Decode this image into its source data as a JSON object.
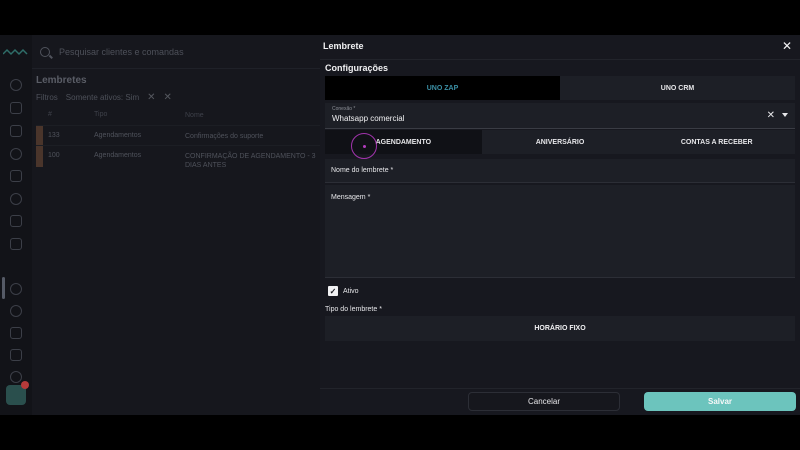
{
  "app": {
    "search_placeholder": "Pesquisar clientes e comandas",
    "page_title": "Lembretes",
    "filters_label": "Filtros",
    "filter_chip": "Somente ativos: Sim",
    "table": {
      "headers": [
        "#",
        "Tipo",
        "Nome"
      ],
      "rows": [
        {
          "id": "133",
          "tipo": "Agendamentos",
          "nome": "Confirmações do suporte"
        },
        {
          "id": "100",
          "tipo": "Agendamentos",
          "nome": "CONFIRMAÇÃO DE AGENDAMENTO - 3 DIAS ANTES"
        }
      ]
    }
  },
  "drawer": {
    "title": "Lembrete",
    "section_title": "Configurações",
    "segment": {
      "options": [
        "UNO ZAP",
        "UNO CRM"
      ],
      "selected": "UNO ZAP"
    },
    "connection": {
      "label": "Conexão",
      "required_mark": "*",
      "value": "Whatsapp comercial"
    },
    "tabs": {
      "items": [
        "AGENDAMENTO",
        "ANIVERSÁRIO",
        "CONTAS A RECEBER"
      ],
      "selected": "AGENDAMENTO"
    },
    "name_field": {
      "label": "Nome do lembrete",
      "required_mark": "*",
      "value": ""
    },
    "message_field": {
      "label": "Mensagem",
      "required_mark": "*",
      "value": ""
    },
    "active_checkbox": {
      "label": "Ativo",
      "checked": true
    },
    "reminder_type": {
      "label": "Tipo do lembrete",
      "required_mark": "*",
      "value": "HORÁRIO FIXO"
    },
    "cancel_label": "Cancelar",
    "save_label": "Salvar"
  },
  "colors": {
    "accent": "#6cc4bd",
    "selected_segment_text": "#3b8fa5",
    "click_indicator": "#a234ad"
  }
}
